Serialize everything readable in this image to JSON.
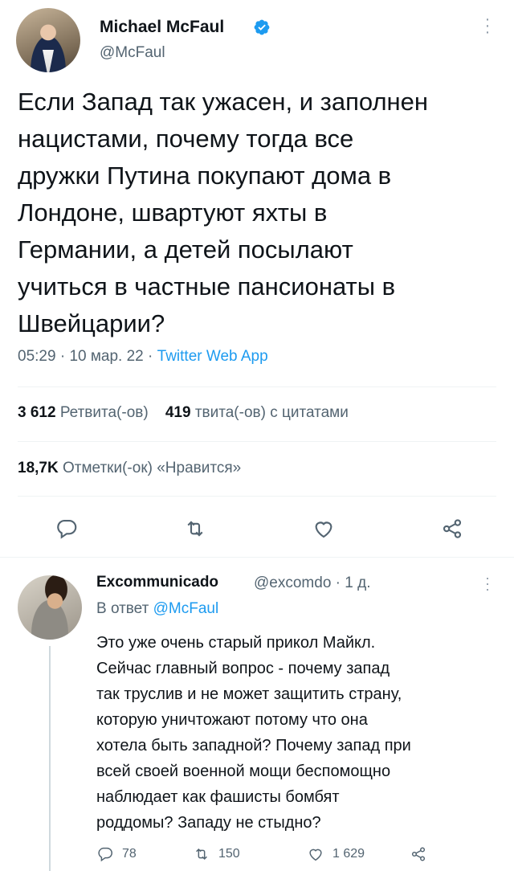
{
  "main_tweet": {
    "author_name": "Michael McFaul",
    "handle": "@McFaul",
    "text": "Если Запад так ужасен, и заполнен\nнацистами, почему тогда все\nдружки Путина покупают дома в\nЛондоне, швартуют яхты в\nГермании, а детей посылают\nучиться в частные пансионаты в\nШвейцарии?",
    "time": "05:29",
    "date": "10 мар. 22",
    "source_app": "Twitter Web App",
    "retweets_count": "3 612",
    "retweets_label": "Ретвита(-ов)",
    "quotes_count": "419",
    "quotes_label": "твита(-ов) с цитатами",
    "likes_count": "18,7K",
    "likes_label": "Отметки(-ок) «Нравится»"
  },
  "reply": {
    "author_name": "Excommunicado",
    "handle": "@excomdo",
    "age": "1 д.",
    "replying_prefix": "В ответ",
    "replying_to": "@McFaul",
    "text": "Это уже очень старый прикол Майкл.\nСейчас главный вопрос - почему запад\nтак труслив и не может защитить страну,\nкоторую уничтожают потому что она\nхотела быть западной? Почему запад при\nвсей своей военной мощи беспомощно\nнаблюдает как фашисты бомбят\nроддомы? Западу не стыдно?",
    "reply_count": "78",
    "retweet_count": "150",
    "like_count": "1 629"
  },
  "icons": {
    "verified": "verified-badge-icon",
    "reply": "reply-icon",
    "retweet": "retweet-icon",
    "like": "heart-icon",
    "share": "share-icon",
    "more": "more-vertical-icon"
  },
  "colors": {
    "accent": "#1d9bf0",
    "text": "#0f1419",
    "secondary": "#536471"
  }
}
